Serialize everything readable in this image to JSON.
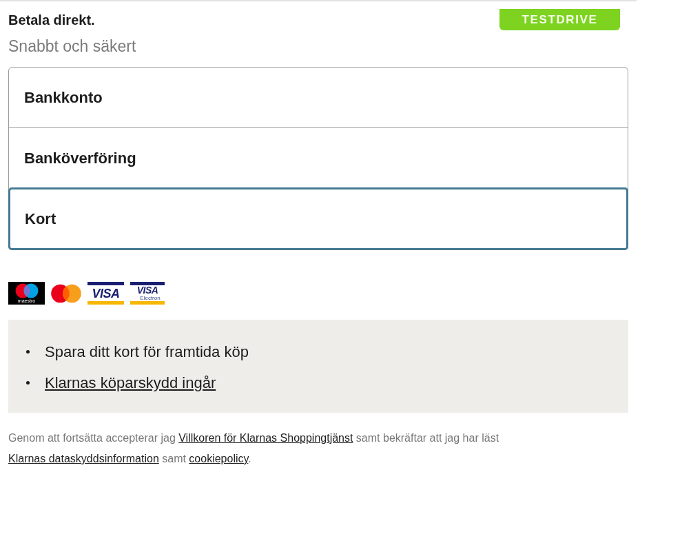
{
  "header": {
    "title": "Betala direkt.",
    "subtitle": "Snabbt och säkert",
    "badge": "TESTDRIVE"
  },
  "payment_options": [
    {
      "label": "Bankkonto",
      "selected": false
    },
    {
      "label": "Banköverföring",
      "selected": false
    },
    {
      "label": "Kort",
      "selected": true
    }
  ],
  "card_logos": [
    {
      "kind": "maestro",
      "text": "maestro"
    },
    {
      "kind": "mastercard"
    },
    {
      "kind": "visa",
      "text": "VISA"
    },
    {
      "kind": "visa-electron",
      "text": "VISA",
      "subtext": "Electron"
    }
  ],
  "benefits": [
    {
      "kind": "text",
      "text": "Spara ditt kort för framtida köp"
    },
    {
      "kind": "link",
      "text": "Klarnas köparskydd ingår"
    }
  ],
  "legal_text": [
    {
      "kind": "text",
      "text": "Genom att fortsätta accepterar jag "
    },
    {
      "kind": "link",
      "text": "Villkoren för Klarnas Shoppingtjänst"
    },
    {
      "kind": "text",
      "text": " samt bekräftar att jag har läst "
    },
    {
      "kind": "link",
      "text": "Klarnas dataskyddsinformation"
    },
    {
      "kind": "text",
      "text": " samt "
    },
    {
      "kind": "link",
      "text": "cookiepolicy"
    },
    {
      "kind": "text",
      "text": "."
    }
  ]
}
